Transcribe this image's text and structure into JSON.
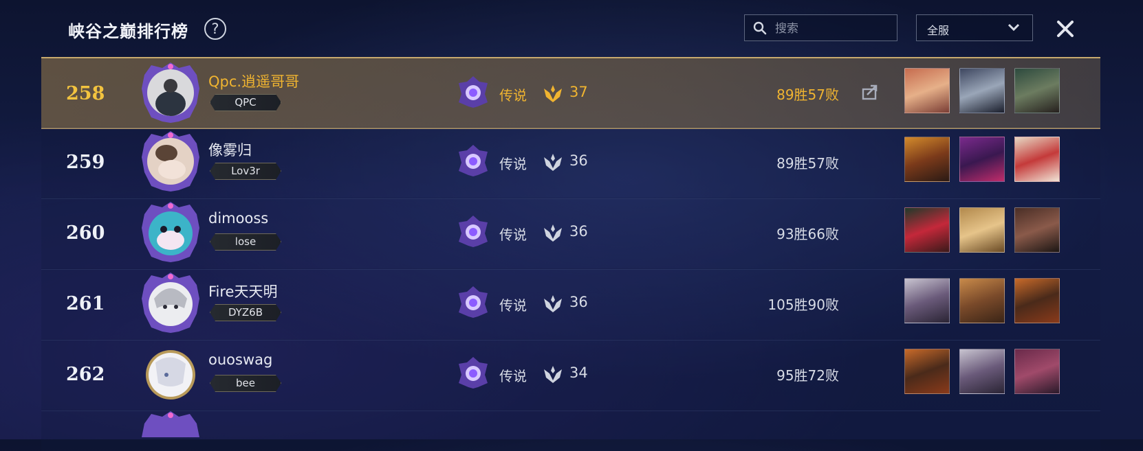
{
  "header": {
    "title": "峡谷之巅排行榜",
    "help_label": "?",
    "search_placeholder": "搜索",
    "region_select": "全服"
  },
  "rows": [
    {
      "rank": "258",
      "name": "Qpc.逍遥哥哥",
      "tag": "QPC",
      "tier": "传说",
      "points": "37",
      "record": "89胜57败",
      "highlighted": true
    },
    {
      "rank": "259",
      "name": "像雾归",
      "tag": "Lov3r",
      "tier": "传说",
      "points": "36",
      "record": "89胜57败",
      "highlighted": false
    },
    {
      "rank": "260",
      "name": "dimooss",
      "tag": "lose",
      "tier": "传说",
      "points": "36",
      "record": "93胜66败",
      "highlighted": false
    },
    {
      "rank": "261",
      "name": "Fire天天明",
      "tag": "DYZ6B",
      "tier": "传说",
      "points": "36",
      "record": "105胜90败",
      "highlighted": false
    },
    {
      "rank": "262",
      "name": "ouoswag",
      "tag": "bee",
      "tier": "传说",
      "points": "34",
      "record": "95胜72败",
      "highlighted": false
    }
  ],
  "colors": {
    "highlight_gold": "#f0b430",
    "border_gold": "#c8aa6e",
    "background": "#141d46"
  },
  "icons": [
    "search-icon",
    "chevron-down-icon",
    "close-icon",
    "help-icon",
    "share-icon",
    "tier-emblem-icon",
    "laurel-icon"
  ]
}
